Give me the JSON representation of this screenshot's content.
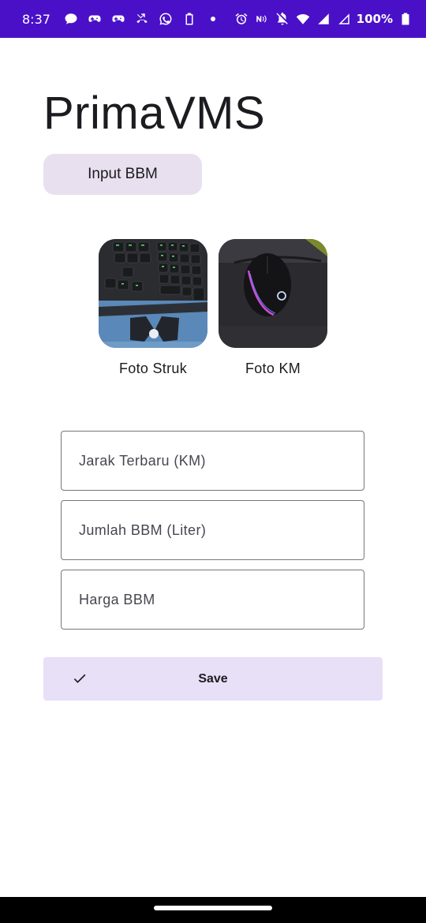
{
  "status_bar": {
    "time": "8:37",
    "battery": "100%",
    "background_color": "#4a10c8",
    "left_icons": [
      "chat-bubble-icon",
      "gamepad-icon",
      "gamepad-icon",
      "missed-call-icon",
      "whatsapp-icon",
      "battery-saver-icon",
      "dot-icon"
    ],
    "right_icons": [
      "alarm-icon",
      "nfc-icon",
      "mute-icon",
      "wifi-icon",
      "signal-icon",
      "signal-icon",
      "battery-icon"
    ]
  },
  "app": {
    "title": "PrimaVMS",
    "input_button_label": "Input BBM",
    "accent_color": "#e8e0ef"
  },
  "photos": [
    {
      "label": "Foto Struk",
      "image": "keyboard-photo"
    },
    {
      "label": "Foto KM",
      "image": "mouse-photo"
    }
  ],
  "form": {
    "jarak_placeholder": "Jarak Terbaru (KM)",
    "jumlah_placeholder": "Jumlah BBM (Liter)",
    "harga_placeholder": "Harga BBM"
  },
  "save": {
    "label": "Save",
    "icon": "check-icon",
    "color": "#e7e0f7"
  }
}
